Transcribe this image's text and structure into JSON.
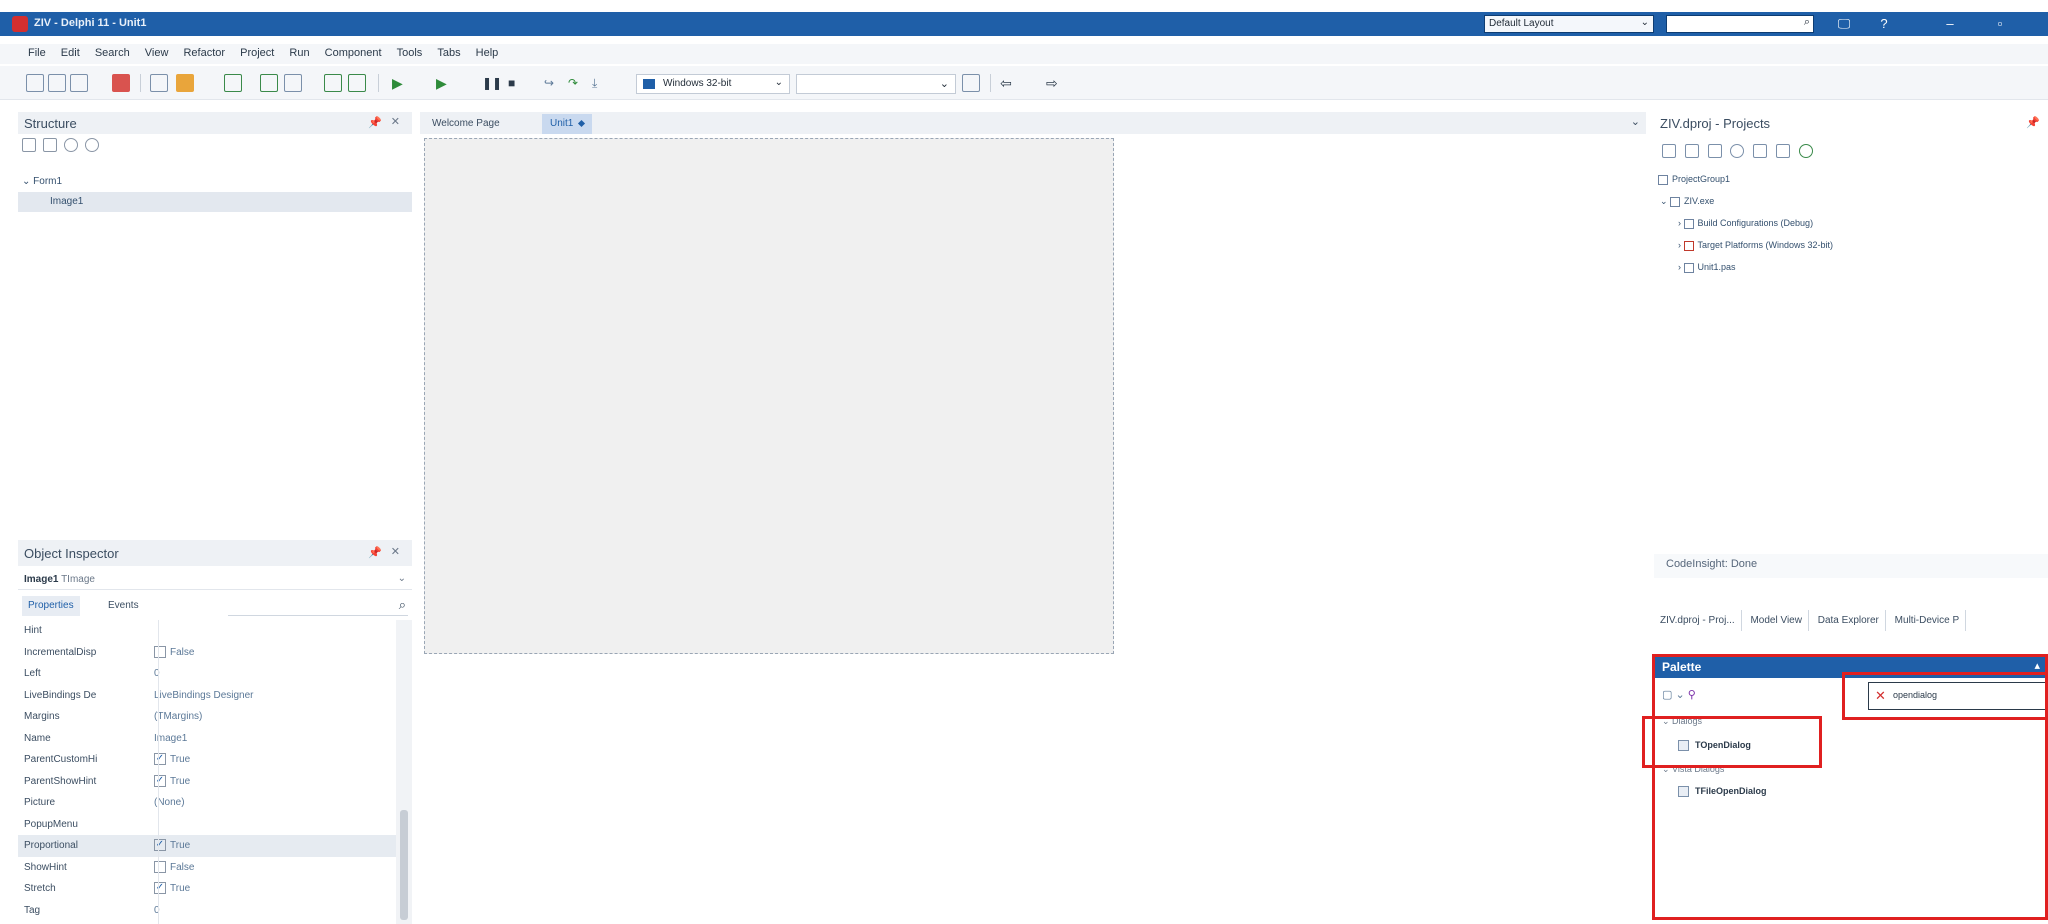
{
  "window": {
    "title": "ZIV - Delphi 11 - Unit1",
    "layout_select": "Default Layout",
    "search_value": "",
    "controls": [
      "🖵",
      "?",
      "–",
      "▫"
    ]
  },
  "menu": [
    "File",
    "Edit",
    "Search",
    "View",
    "Refactor",
    "Project",
    "Run",
    "Component",
    "Tools",
    "Tabs",
    "Help"
  ],
  "toolbar": {
    "platform": "Windows 32-bit",
    "config": ""
  },
  "structure": {
    "title": "Structure",
    "tree": [
      {
        "label": "Form1",
        "indent": 0
      },
      {
        "label": "Image1",
        "indent": 1
      }
    ]
  },
  "inspector": {
    "title": "Object Inspector",
    "object": "Image1",
    "object_type": "TImage",
    "tabs": [
      "Properties",
      "Events"
    ],
    "properties": [
      {
        "name": "Hint",
        "value": "",
        "check": null
      },
      {
        "name": "IncrementalDisp",
        "value": "False",
        "check": false
      },
      {
        "name": "Left",
        "value": "0",
        "check": null
      },
      {
        "name": "LiveBindings De",
        "value": "LiveBindings Designer",
        "check": null
      },
      {
        "name": "Margins",
        "value": "(TMargins)",
        "check": null
      },
      {
        "name": "Name",
        "value": "Image1",
        "check": null
      },
      {
        "name": "ParentCustomHi",
        "value": "True",
        "check": true
      },
      {
        "name": "ParentShowHint",
        "value": "True",
        "check": true
      },
      {
        "name": "Picture",
        "value": "(None)",
        "check": null
      },
      {
        "name": "PopupMenu",
        "value": "",
        "check": null
      },
      {
        "name": "Proportional",
        "value": "True",
        "check": true
      },
      {
        "name": "ShowHint",
        "value": "False",
        "check": false
      },
      {
        "name": "Stretch",
        "value": "True",
        "check": true
      },
      {
        "name": "Tag",
        "value": "0",
        "check": null
      }
    ]
  },
  "editor": {
    "tabs": [
      "Welcome Page",
      "Unit1"
    ],
    "active_tab": "Unit1"
  },
  "projects": {
    "title": "ZIV.dproj - Projects",
    "tree": [
      {
        "label": "ProjectGroup1",
        "level": 0,
        "icon": "group"
      },
      {
        "label": "ZIV.exe",
        "level": 1,
        "icon": "exe"
      },
      {
        "label": "Build Configurations (Debug)",
        "level": 2,
        "icon": "config"
      },
      {
        "label": "Target Platforms (Windows 32-bit)",
        "level": 2,
        "icon": "platform"
      },
      {
        "label": "Unit1.pas",
        "level": 2,
        "icon": "file"
      }
    ],
    "insight": "CodeInsight: Done",
    "tabs": [
      "ZIV.dproj - Proj...",
      "Model View",
      "Data Explorer",
      "Multi-Device P"
    ]
  },
  "palette": {
    "title": "Palette",
    "search_value": "opendialog",
    "categories": [
      {
        "name": "Dialogs",
        "items": [
          "TOpenDialog"
        ]
      },
      {
        "name": "Vista Dialogs",
        "items": [
          "TFileOpenDialog"
        ]
      }
    ]
  },
  "colors": {
    "titlebar": "#1f5fa8",
    "highlight": "#e02020"
  }
}
